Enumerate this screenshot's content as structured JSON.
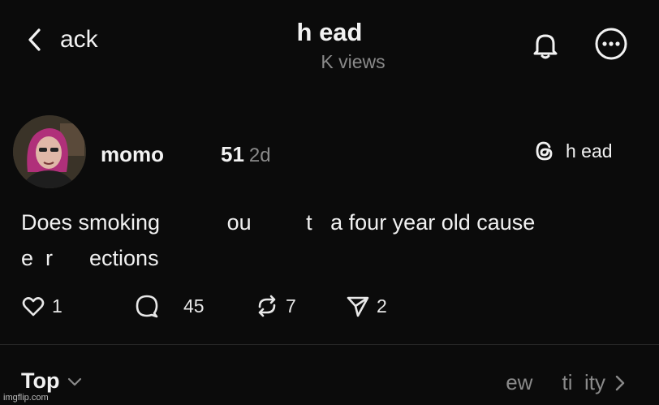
{
  "header": {
    "back_label": "ack",
    "title": "h ead",
    "views": "K views"
  },
  "post": {
    "author": "momo",
    "author_suffix": "51",
    "age": "2d",
    "source_tag": "h ead",
    "text": "Does smoking           ou         t   a four year old cause\ne  r      ections",
    "likes": "1",
    "replies": "45",
    "reposts": "7",
    "shares": "2"
  },
  "footer": {
    "sort_label": "Top",
    "activity_label": "ew     ti  ity"
  },
  "watermark": "imgflip.com",
  "colors": {
    "background": "#0b0b0b",
    "text": "#f2f2f2",
    "muted": "#8a8a8a"
  },
  "icons": [
    "chevron-left-icon",
    "bell-icon",
    "more-icon",
    "threads-icon",
    "heart-icon",
    "comment-icon",
    "repost-icon",
    "send-icon",
    "chevron-down-icon",
    "chevron-right-icon"
  ]
}
